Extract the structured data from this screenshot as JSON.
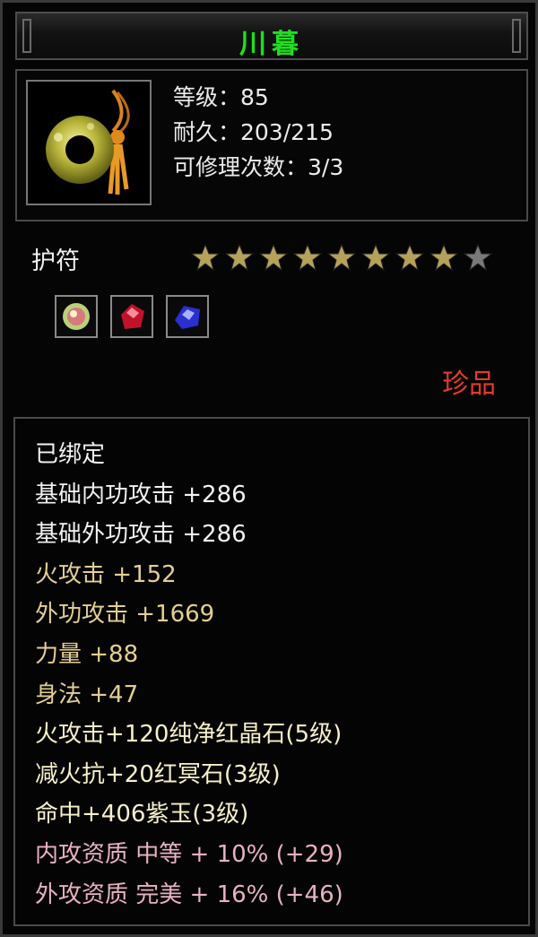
{
  "item": {
    "name": "川暮",
    "level_line": "等级：85",
    "durability_line": "耐久：203/215",
    "repair_line": "可修理次数：3/3",
    "icon": "jade-amulet-icon",
    "type": "护符",
    "stars_filled": 8,
    "stars_total": 9,
    "gems": [
      "flame-gem-icon",
      "red-crystal-icon",
      "purple-jade-icon"
    ],
    "rarity": "珍品",
    "rarity_color": "#e43a2a",
    "name_color": "#1ee01e"
  },
  "stats": [
    {
      "text": "已绑定",
      "tone": "white"
    },
    {
      "text": "基础内功攻击 +286",
      "tone": "white"
    },
    {
      "text": "基础外功攻击 +286",
      "tone": "white"
    },
    {
      "text": "火攻击 +152",
      "tone": "gold"
    },
    {
      "text": "外功攻击 +1669",
      "tone": "gold"
    },
    {
      "text": "力量 +88",
      "tone": "gold"
    },
    {
      "text": "身法 +47",
      "tone": "gold"
    },
    {
      "text": "火攻击+120纯净红晶石(5级)",
      "tone": "light"
    },
    {
      "text": "减火抗+20红冥石(3级)",
      "tone": "light"
    },
    {
      "text": "命中+406紫玉(3级)",
      "tone": "light"
    },
    {
      "text": "内攻资质 中等 + 10% (+29)",
      "tone": "pink"
    },
    {
      "text": "外攻资质 完美 + 16% (+46)",
      "tone": "pink"
    }
  ]
}
